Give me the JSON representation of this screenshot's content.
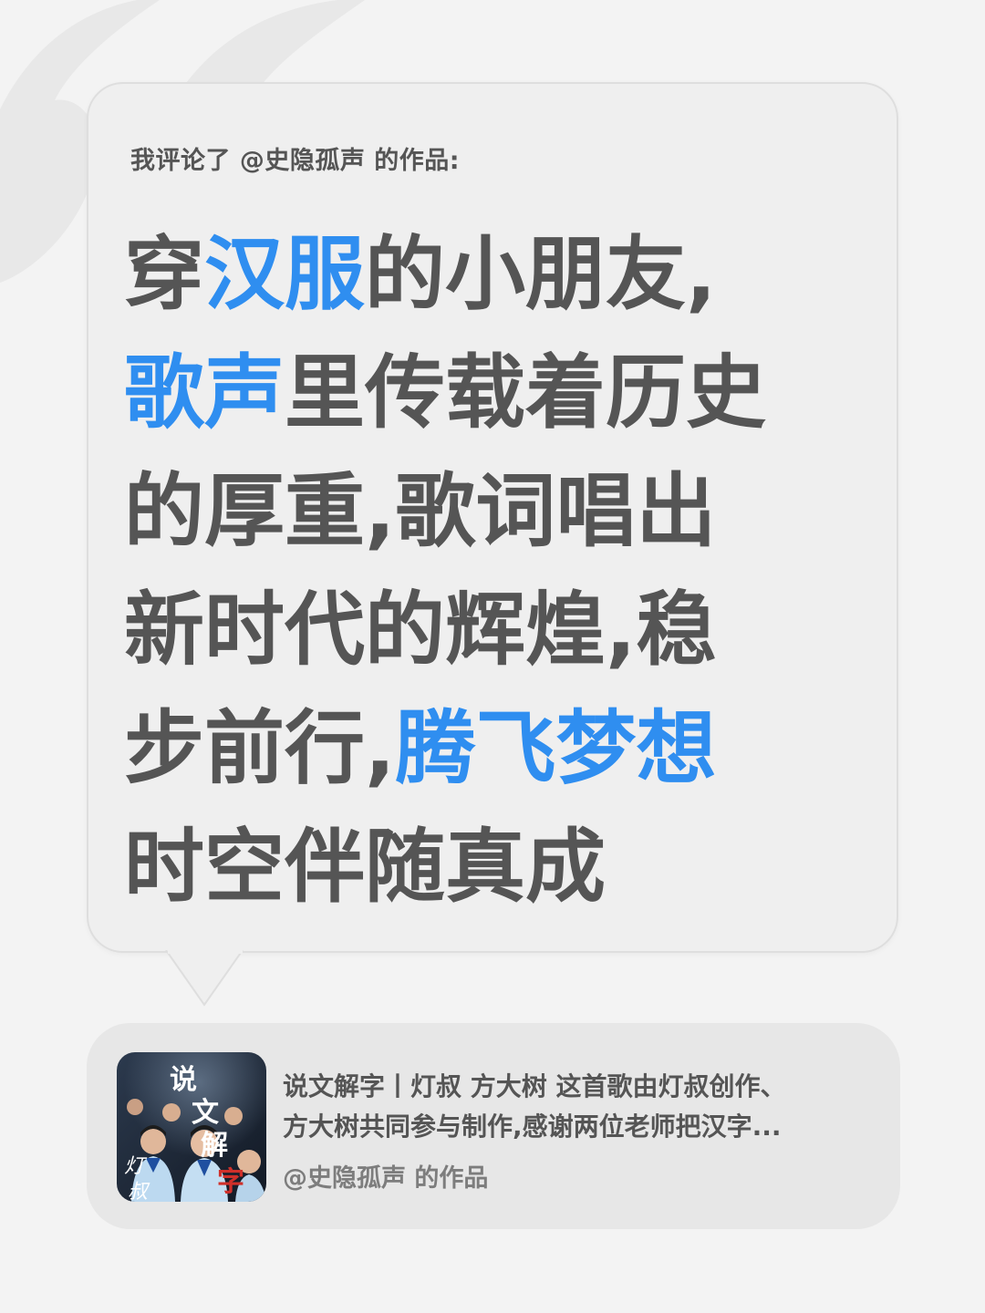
{
  "comment_header": "我评论了 @史隐孤声 的作品:",
  "comment_lines": [
    [
      {
        "text": "穿",
        "hl": false
      },
      {
        "text": "汉服",
        "hl": true
      },
      {
        "text": "的小朋友,",
        "hl": false
      }
    ],
    [
      {
        "text": "歌声",
        "hl": true
      },
      {
        "text": "里传载着历史",
        "hl": false
      }
    ],
    [
      {
        "text": "的厚重,歌词唱出",
        "hl": false
      }
    ],
    [
      {
        "text": "新时代的辉煌,稳",
        "hl": false
      }
    ],
    [
      {
        "text": "步前行,",
        "hl": false
      },
      {
        "text": "腾飞梦想",
        "hl": true
      }
    ],
    [
      {
        "text": "时空伴随真成",
        "hl": false
      }
    ]
  ],
  "work_card": {
    "description_line1": "说文解字丨灯叔 方大树 这首歌由灯叔创作、",
    "description_line2": "方大树共同参与制作,感谢两位老师把汉字...",
    "author": "@史隐孤声 的作品",
    "thumbnail_calligraphy": "说文解字",
    "thumbnail_subtitle": "灯叔"
  },
  "colors": {
    "background": "#f3f3f3",
    "bubble": "#efefef",
    "text": "#555555",
    "highlight": "#2f8ef0",
    "card": "#e7e7e7",
    "muted": "#7d7d7d"
  },
  "icons": {
    "decoration": "quote-mark-icon",
    "thumbnail": "video-thumbnail"
  }
}
